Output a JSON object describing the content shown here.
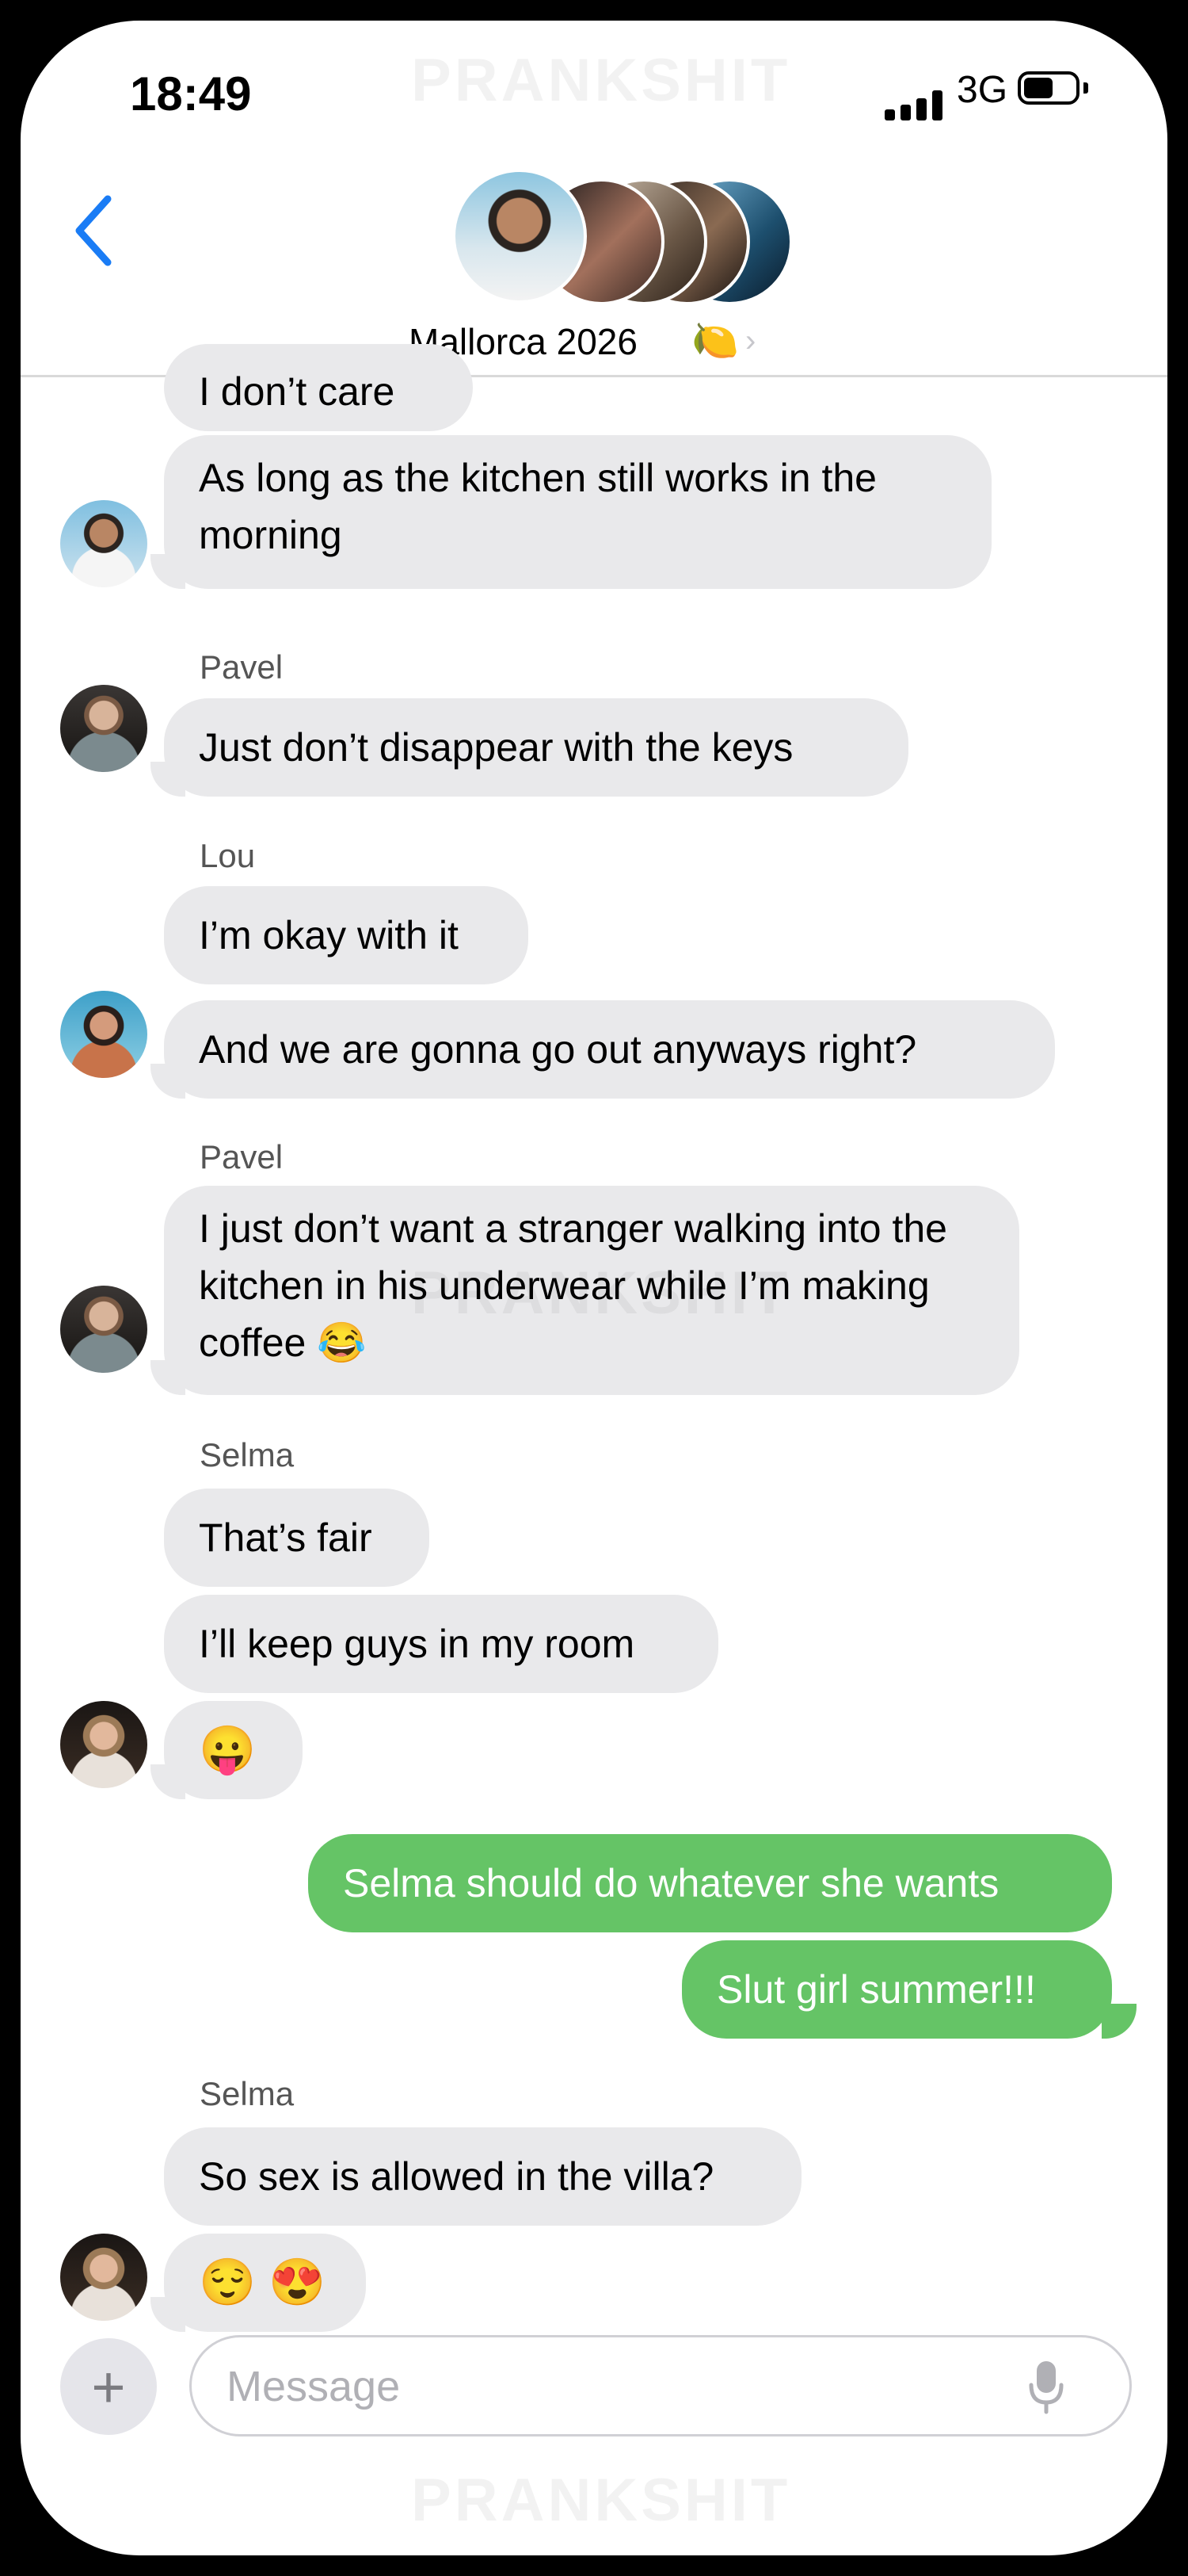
{
  "status_bar": {
    "time": "18:49",
    "network": "3G"
  },
  "watermark": "PRANKSHIT",
  "header": {
    "title": "Mallorca 2026",
    "title_emoji": "🍋",
    "chevron": "›",
    "back_icon": "chevron-left-icon"
  },
  "colors": {
    "accent": "#1a7cf5",
    "incoming_bubble": "#e9e9eb",
    "outgoing_bubble": "#65c466"
  },
  "messages": [
    {
      "text": "I don’t care"
    },
    {
      "text": "As long as the kitchen still works in the morning"
    },
    {
      "sender": "Pavel",
      "text": "Just don’t disappear with the keys"
    },
    {
      "sender": "Lou",
      "text": "I’m okay with it"
    },
    {
      "text": "And we are gonna go out anyways right?"
    },
    {
      "sender": "Pavel",
      "text": "I just don’t want a stranger walking into the kitchen in his underwear while I’m making coffee 😂"
    },
    {
      "sender": "Selma",
      "text": "That’s fair"
    },
    {
      "text": "I’ll keep guys in my room"
    },
    {
      "text": "😛"
    },
    {
      "text": "Selma should do whatever she wants"
    },
    {
      "text": "Slut girl summer!!!"
    },
    {
      "sender": "Selma",
      "text": "So sex is allowed in the villa?"
    },
    {
      "text": "😌 😍"
    }
  ],
  "composer": {
    "plus": "+",
    "placeholder": "Message",
    "mic_icon": "microphone-icon"
  }
}
